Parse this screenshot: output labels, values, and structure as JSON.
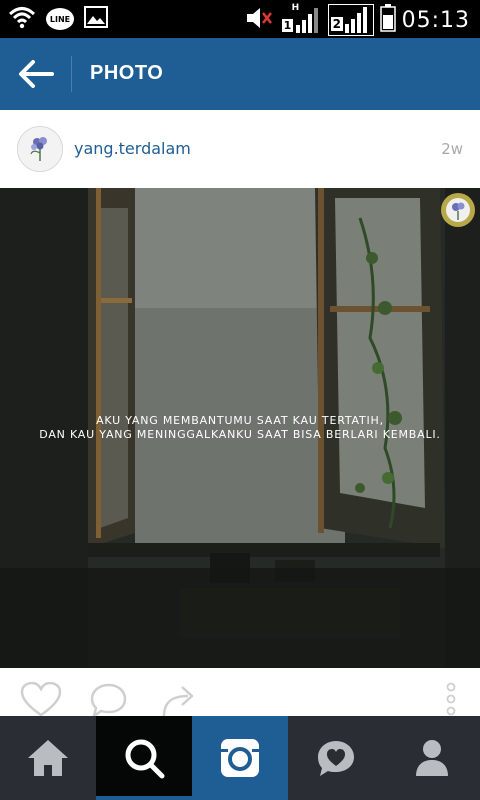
{
  "status_bar": {
    "time": "05:13",
    "line_label": "LINE",
    "sim1_label": "1",
    "sim2_label": "2",
    "network_label": "H",
    "icons": [
      "wifi-icon",
      "line-app-icon",
      "gallery-icon",
      "mute-icon",
      "signal-sim1-icon",
      "signal-sim2-icon",
      "battery-icon"
    ]
  },
  "header": {
    "title": "PHOTO",
    "back_icon": "arrow-left-icon"
  },
  "post": {
    "username": "yang.terdalam",
    "age": "2w",
    "caption_line1": "AKU YANG MEMBANTUMU SAAT KAU TERTATIH,",
    "caption_line2": "DAN KAU YANG MENINGGALKANKU SAAT BISA BERLARI KEMBALI."
  },
  "actions": {
    "icons": [
      "heart-icon",
      "comment-icon",
      "share-icon",
      "more-vertical-icon"
    ]
  },
  "bottom_nav": {
    "items": [
      "home-icon",
      "search-icon",
      "camera-icon",
      "activity-heart-icon",
      "profile-icon"
    ],
    "active": "search",
    "colors": {
      "bar": "#2a2d33",
      "active_bg": "#050606",
      "camera_bg": "#1f5e95",
      "icon": "#b9bcc1"
    }
  },
  "colors": {
    "brand_blue": "#1f5e95",
    "username": "#1f5e95",
    "muted_text": "#a9a9a9"
  }
}
